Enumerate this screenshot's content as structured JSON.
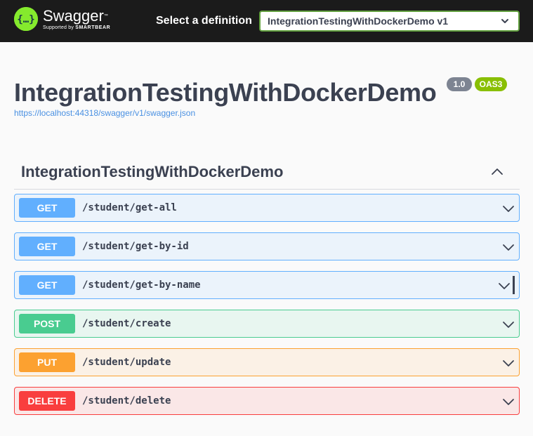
{
  "topbar": {
    "logo_name": "Swagger",
    "logo_supported": "Supported by",
    "logo_company": "SMARTBEAR",
    "definition_label": "Select a definition",
    "definition_selected": "IntegrationTestingWithDockerDemo v1"
  },
  "info": {
    "title": "IntegrationTestingWithDockerDemo",
    "version": "1.0",
    "oas_badge": "OAS3",
    "url": "https://localhost:44318/swagger/v1/swagger.json"
  },
  "tag": {
    "name": "IntegrationTestingWithDockerDemo",
    "expanded": true
  },
  "operations": [
    {
      "method": "GET",
      "path": "/student/get-all"
    },
    {
      "method": "GET",
      "path": "/student/get-by-id"
    },
    {
      "method": "GET",
      "path": "/student/get-by-name"
    },
    {
      "method": "POST",
      "path": "/student/create"
    },
    {
      "method": "PUT",
      "path": "/student/update"
    },
    {
      "method": "DELETE",
      "path": "/student/delete"
    }
  ],
  "colors": {
    "topbar": "#1b1b1b",
    "brand": "#85ea2d",
    "get": "#61affe",
    "post": "#49cc90",
    "put": "#fca130",
    "delete": "#f93e3e",
    "version_badge": "#7d8492",
    "oas_badge": "#89bf04",
    "link": "#4990e2"
  },
  "icons": {
    "logo": "swagger-logo-icon",
    "select": "chevron-down-icon",
    "tag_toggle": "chevron-up-icon",
    "operation_toggle": "chevron-down-icon"
  }
}
